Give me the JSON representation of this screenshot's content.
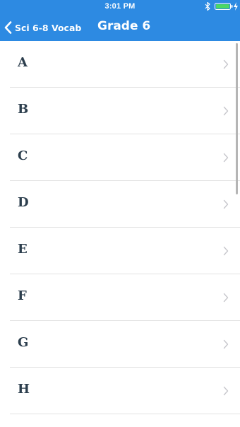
{
  "status_bar": {
    "time": "3:01 PM",
    "icons": [
      "bluetooth-icon",
      "battery-icon",
      "charging-icon"
    ],
    "battery_color": "#4cd964"
  },
  "nav": {
    "back_label": "Sci 6-8 Vocab",
    "title": "Grade 6"
  },
  "list": {
    "items": [
      {
        "label": "A"
      },
      {
        "label": "B"
      },
      {
        "label": "C"
      },
      {
        "label": "D"
      },
      {
        "label": "E"
      },
      {
        "label": "F"
      },
      {
        "label": "G"
      },
      {
        "label": "H"
      }
    ]
  },
  "colors": {
    "header_bg": "#2d8ae2",
    "letter_text": "#2c3e4d",
    "divider": "#e2e2e2",
    "chevron": "#c7c7cc"
  }
}
